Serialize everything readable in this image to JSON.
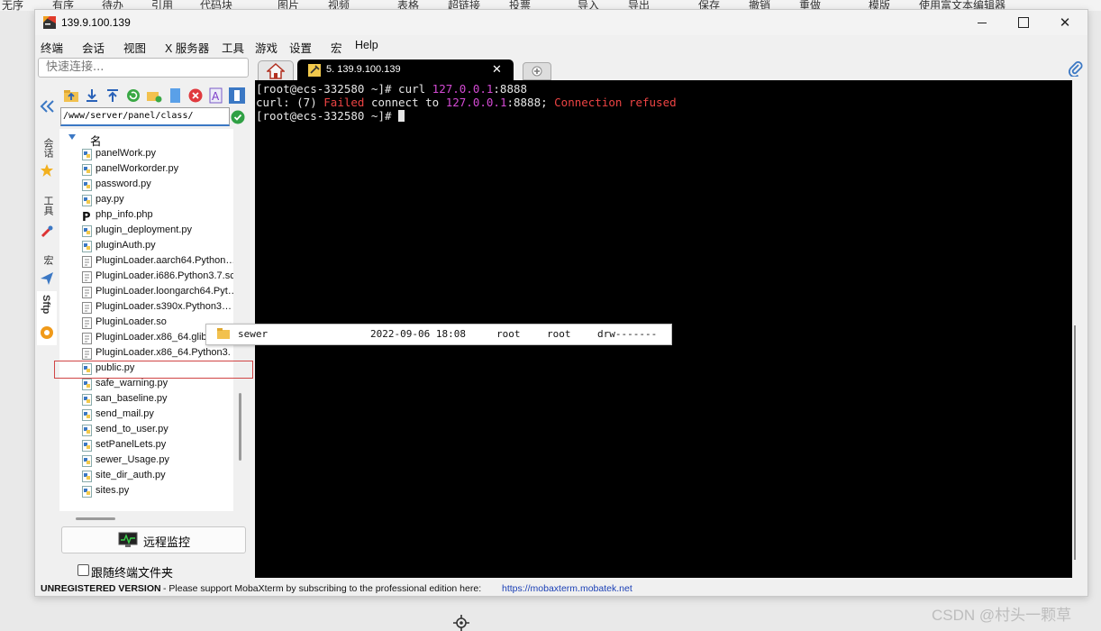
{
  "background_toolbar": [
    "无序",
    "有序",
    "待办",
    "引用",
    "代码块",
    "图片",
    "视频",
    "表格",
    "超链接",
    "投票",
    "导入",
    "导出",
    "保存",
    "撤销",
    "重做",
    "模版",
    "使用富文本编辑器"
  ],
  "window": {
    "title": "139.9.100.139"
  },
  "menu": [
    "终端",
    "会话",
    "视图",
    "X 服务器",
    "工具",
    "游戏",
    "设置",
    "宏",
    "Help"
  ],
  "quick_connect": {
    "placeholder": "快速连接..."
  },
  "tabs": {
    "session_label": "5. 139.9.100.139"
  },
  "sidebar_tabs": [
    "会话",
    "工具",
    "宏",
    "Sftp"
  ],
  "sftp": {
    "path": "/www/server/panel/class/",
    "column_name": "名",
    "files": [
      {
        "name": "panelWork.py",
        "type": "py"
      },
      {
        "name": "panelWorkorder.py",
        "type": "py"
      },
      {
        "name": "password.py",
        "type": "py"
      },
      {
        "name": "pay.py",
        "type": "py"
      },
      {
        "name": "php_info.php",
        "type": "php"
      },
      {
        "name": "plugin_deployment.py",
        "type": "py"
      },
      {
        "name": "pluginAuth.py",
        "type": "py"
      },
      {
        "name": "PluginLoader.aarch64.Python…",
        "type": "so"
      },
      {
        "name": "PluginLoader.i686.Python3.7.sc",
        "type": "so"
      },
      {
        "name": "PluginLoader.loongarch64.Pyt…",
        "type": "so"
      },
      {
        "name": "PluginLoader.s390x.Python3…",
        "type": "so"
      },
      {
        "name": "PluginLoader.so",
        "type": "so"
      },
      {
        "name": "PluginLoader.x86_64.glib",
        "type": "so"
      },
      {
        "name": "PluginLoader.x86_64.Python3.",
        "type": "so"
      },
      {
        "name": "public.py",
        "type": "py"
      },
      {
        "name": "safe_warning.py",
        "type": "py"
      },
      {
        "name": "san_baseline.py",
        "type": "py"
      },
      {
        "name": "send_mail.py",
        "type": "py"
      },
      {
        "name": "send_to_user.py",
        "type": "py"
      },
      {
        "name": "setPanelLets.py",
        "type": "py"
      },
      {
        "name": "sewer_Usage.py",
        "type": "py"
      },
      {
        "name": "site_dir_auth.py",
        "type": "py"
      },
      {
        "name": "sites.py",
        "type": "py"
      }
    ],
    "remote_monitor_label": "远程监控",
    "follow_terminal_label": "跟随终端文件夹"
  },
  "terminal": {
    "line1": {
      "prompt": "[root@ecs-332580 ~]# curl ",
      "ip": "127.0.0.1",
      "port": ":8888"
    },
    "line2": {
      "prefix": "curl: (7) ",
      "failed": "Failed",
      "middle": " connect to ",
      "ip": "127.0.0.1",
      "port": ":8888; ",
      "refused": "Connection refused"
    },
    "line3": {
      "prompt": "[root@ecs-332580 ~]# "
    }
  },
  "drag_tooltip": {
    "name": "sewer",
    "date": "2022-09-06 18:08",
    "owner": "root",
    "group": "root",
    "perms": "drw-------"
  },
  "status": {
    "unregistered": "UNREGISTERED VERSION",
    "message": "-  Please support MobaXterm by subscribing to the professional edition here:",
    "link": "https://mobaxterm.mobatek.net"
  },
  "watermark": "CSDN @村头一颗草",
  "colors": {
    "terminal_bg": "#000000",
    "accent_blue": "#3b78c4",
    "magenta": "#d44ad4",
    "red": "#ee4444"
  }
}
